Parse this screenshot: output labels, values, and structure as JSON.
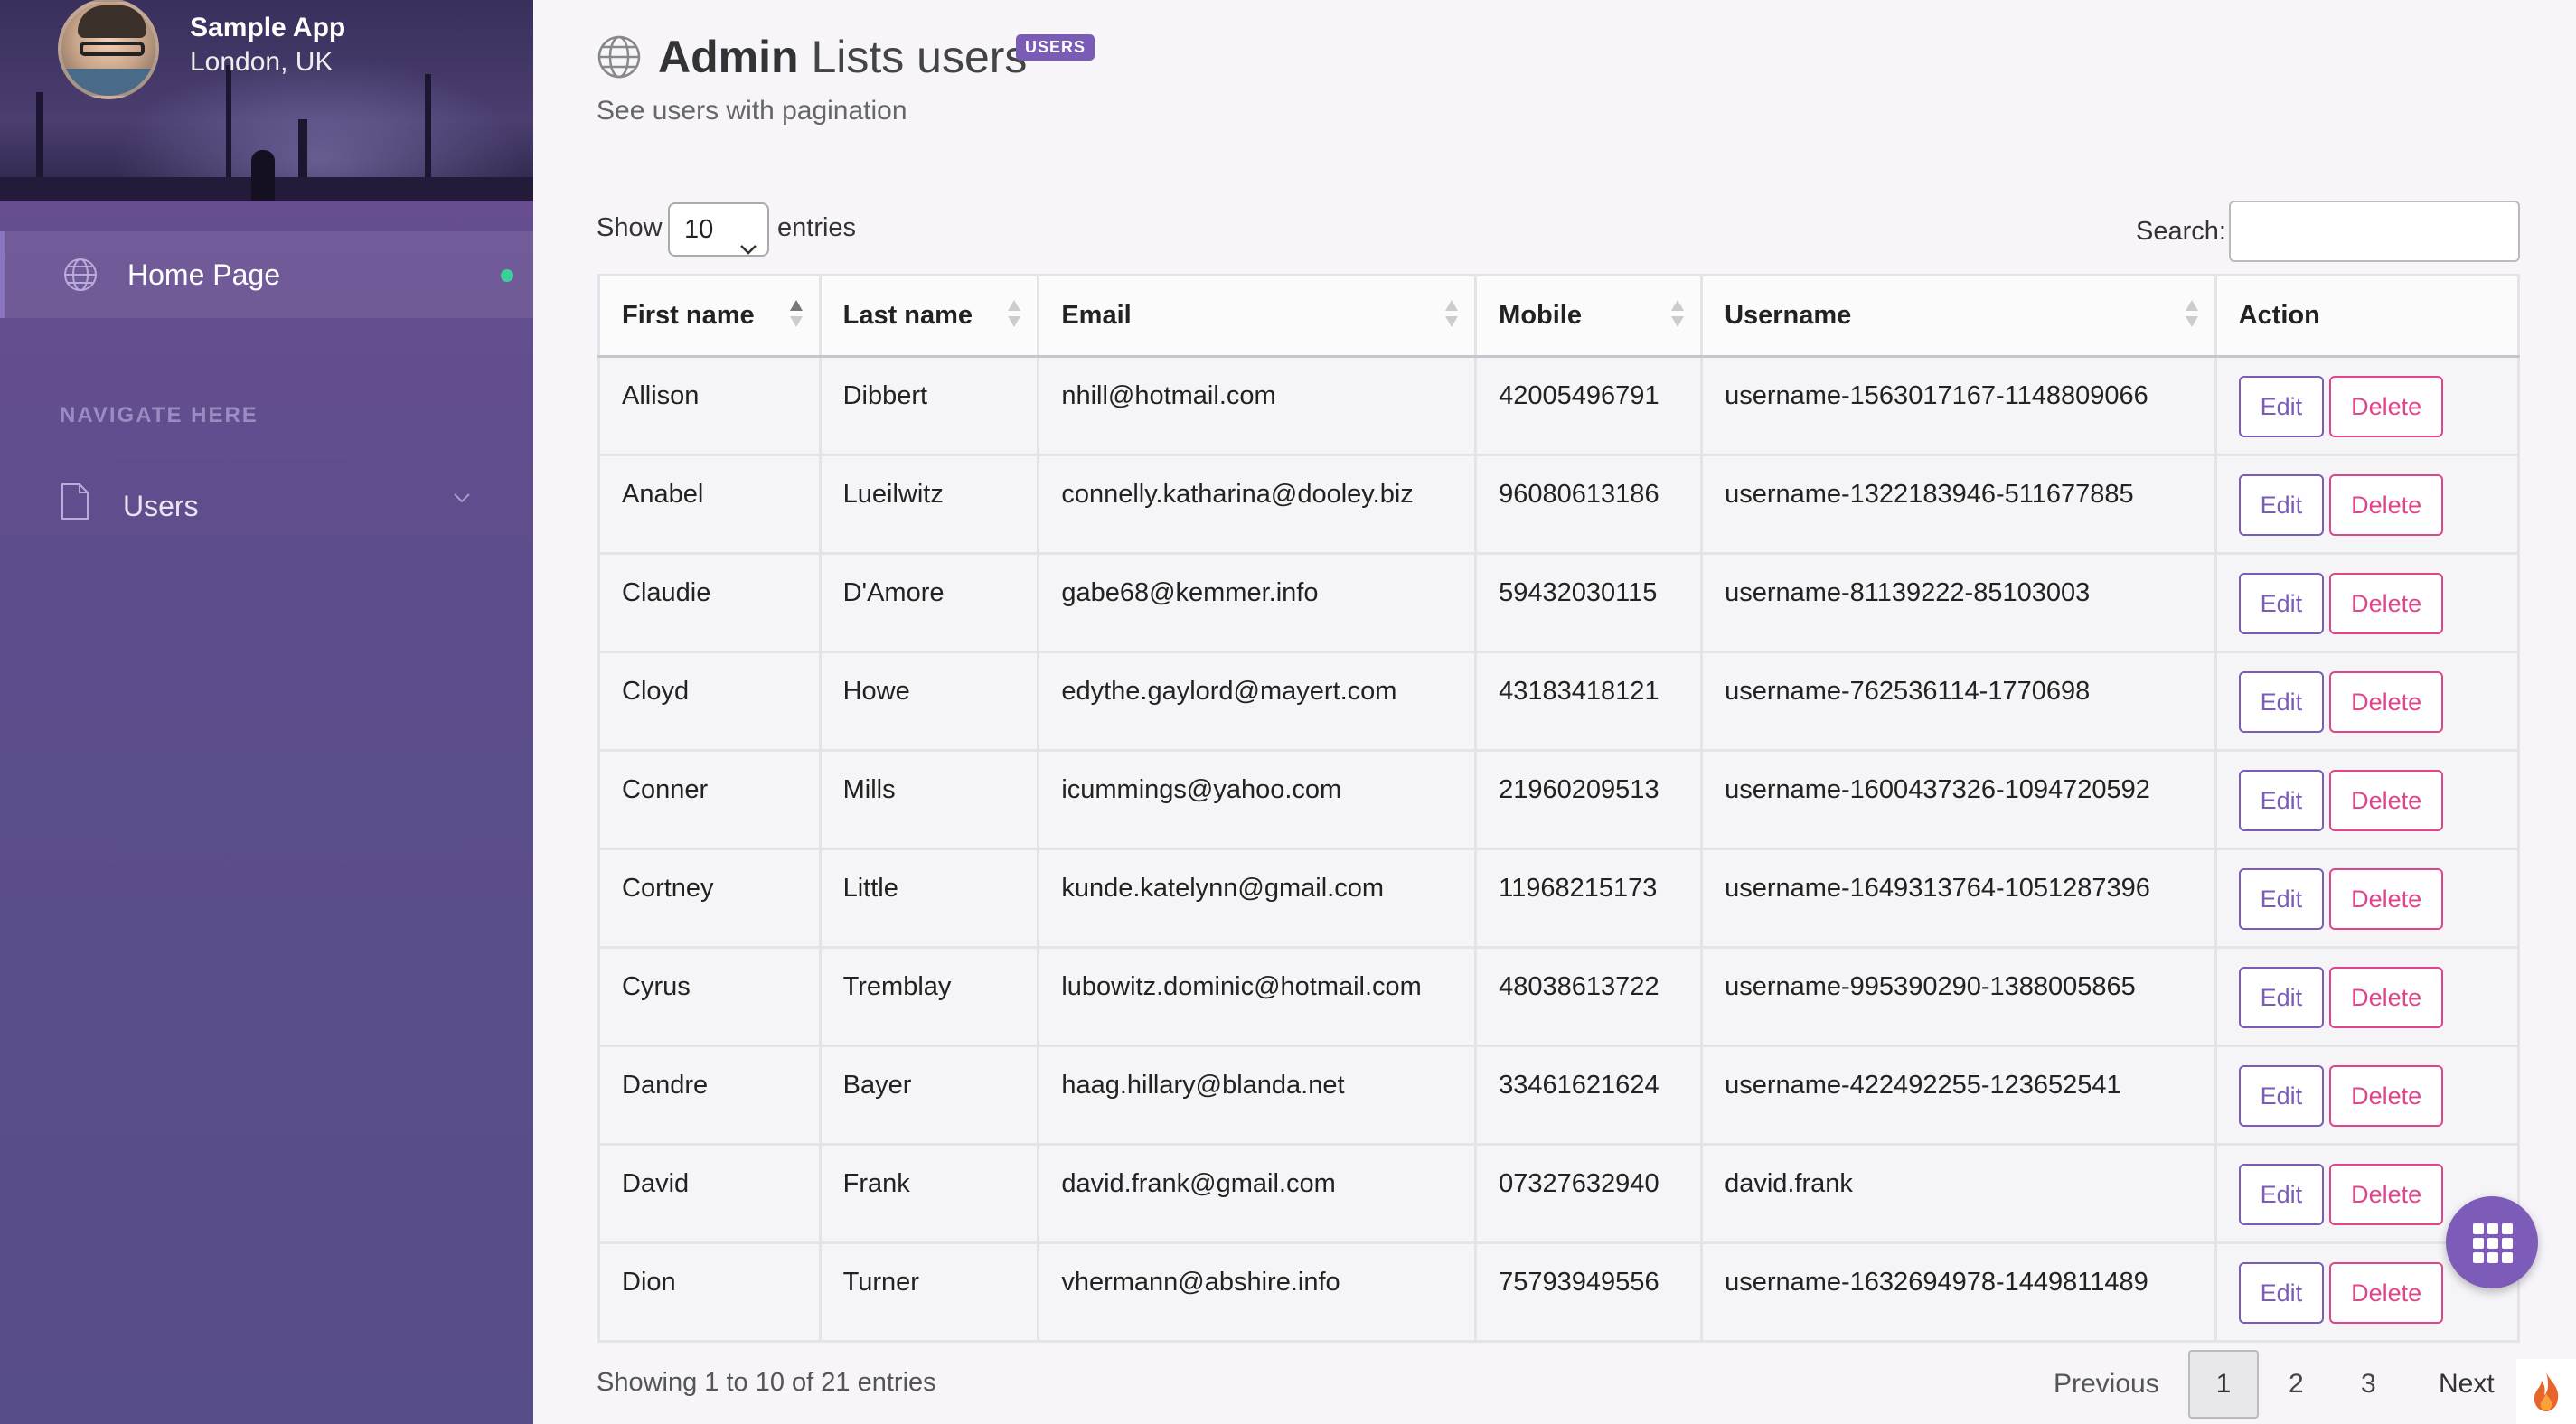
{
  "sidebar": {
    "app_name": "Sample App",
    "location": "London, UK",
    "home_label": "Home Page",
    "section_label": "NAVIGATE HERE",
    "users_label": "Users"
  },
  "header": {
    "title_bold": "Admin",
    "title_rest": "Lists users",
    "badge": "USERS",
    "subtitle": "See users with pagination"
  },
  "controls": {
    "show_label": "Show",
    "entries_value": "10",
    "entries_label": "entries",
    "search_label": "Search:"
  },
  "table": {
    "columns": [
      "First name",
      "Last name",
      "Email",
      "Mobile",
      "Username",
      "Action"
    ],
    "edit_label": "Edit",
    "delete_label": "Delete",
    "rows": [
      {
        "first": "Allison",
        "last": "Dibbert",
        "email": "nhill@hotmail.com",
        "mobile": "42005496791",
        "username": "username-1563017167-1148809066"
      },
      {
        "first": "Anabel",
        "last": "Lueilwitz",
        "email": "connelly.katharina@dooley.biz",
        "mobile": "96080613186",
        "username": "username-1322183946-511677885"
      },
      {
        "first": "Claudie",
        "last": "D'Amore",
        "email": "gabe68@kemmer.info",
        "mobile": "59432030115",
        "username": "username-81139222-85103003"
      },
      {
        "first": "Cloyd",
        "last": "Howe",
        "email": "edythe.gaylord@mayert.com",
        "mobile": "43183418121",
        "username": "username-762536114-1770698"
      },
      {
        "first": "Conner",
        "last": "Mills",
        "email": "icummings@yahoo.com",
        "mobile": "21960209513",
        "username": "username-1600437326-1094720592"
      },
      {
        "first": "Cortney",
        "last": "Little",
        "email": "kunde.katelynn@gmail.com",
        "mobile": "11968215173",
        "username": "username-1649313764-1051287396"
      },
      {
        "first": "Cyrus",
        "last": "Tremblay",
        "email": "lubowitz.dominic@hotmail.com",
        "mobile": "48038613722",
        "username": "username-995390290-1388005865"
      },
      {
        "first": "Dandre",
        "last": "Bayer",
        "email": "haag.hillary@blanda.net",
        "mobile": "33461621624",
        "username": "username-422492255-123652541"
      },
      {
        "first": "David",
        "last": "Frank",
        "email": "david.frank@gmail.com",
        "mobile": "07327632940",
        "username": "david.frank"
      },
      {
        "first": "Dion",
        "last": "Turner",
        "email": "vhermann@abshire.info",
        "mobile": "75793949556",
        "username": "username-1632694978-1449811489"
      }
    ]
  },
  "footer": {
    "showing": "Showing 1 to 10 of 21 entries",
    "previous": "Previous",
    "pages": [
      "1",
      "2",
      "3"
    ],
    "next": "Next"
  },
  "colors": {
    "accent": "#7a5bb5",
    "danger": "#e0448a",
    "status_dot": "#3dcf9a"
  }
}
